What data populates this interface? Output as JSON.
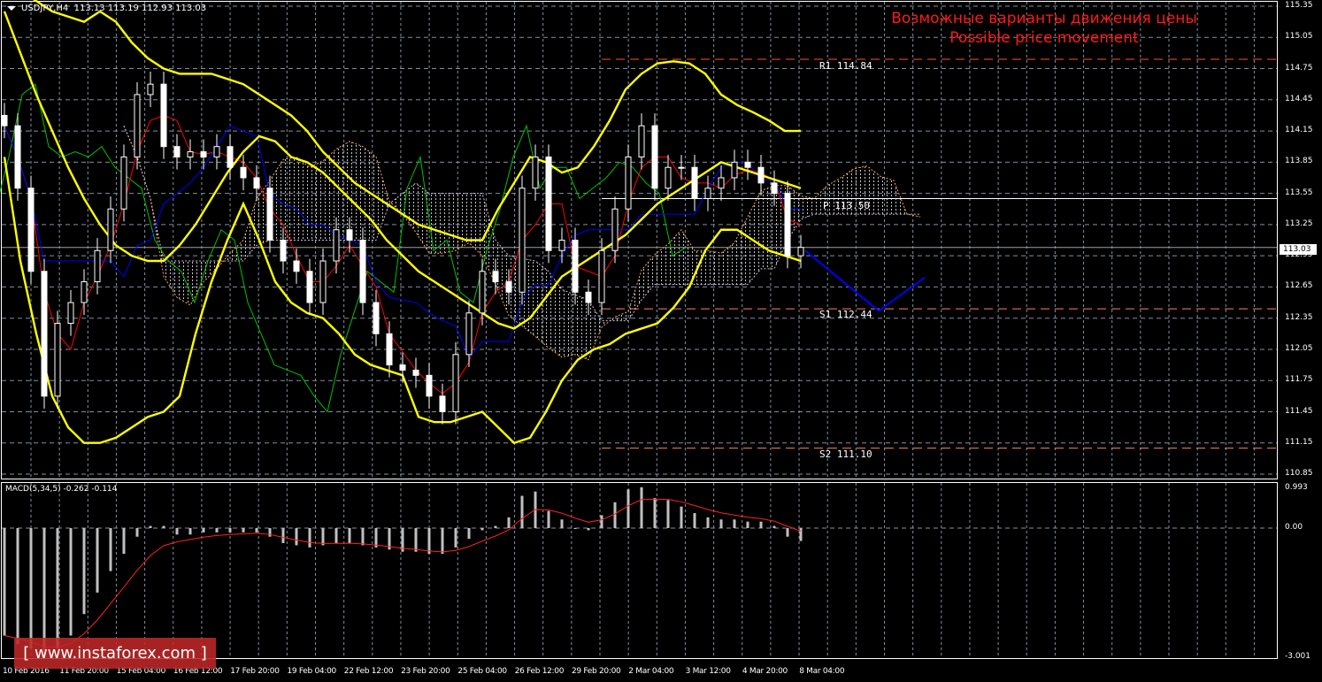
{
  "header": {
    "symbol": "USDJPY,H4",
    "ohlc": "113.13 113.19 112.93 113.03"
  },
  "title": {
    "ru": "Возможные варианты движения цены",
    "en": "Possible price movement"
  },
  "watermark": "[ www.instaforex.com ]",
  "colors": {
    "background": "#000000",
    "bands": "#ffff00",
    "tenkan": "#ff0000",
    "kijun": "#0000ff",
    "chikou": "#00c000",
    "forecast": "#0000ff",
    "title": "#ff1a1a",
    "levels": "#ff6040",
    "grid": "#8090a0"
  },
  "chart_data": [
    {
      "type": "candlestick",
      "title": "USDJPY,H4",
      "ylim": [
        110.85,
        115.35
      ],
      "y_ticks": [
        "115.35",
        "115.05",
        "114.75",
        "114.45",
        "114.15",
        "113.85",
        "113.55",
        "113.25",
        "112.95",
        "112.65",
        "112.35",
        "112.05",
        "111.75",
        "111.45",
        "111.15",
        "110.85"
      ],
      "x_ticks": [
        "10 Feb 2016",
        "11 Feb 20:00",
        "15 Feb 04:00",
        "16 Feb 12:00",
        "17 Feb 20:00",
        "19 Feb 04:00",
        "22 Feb 12:00",
        "23 Feb 20:00",
        "25 Feb 04:00",
        "26 Feb 12:00",
        "29 Feb 20:00",
        "2 Mar 04:00",
        "3 Mar 12:00",
        "4 Mar 20:00",
        "8 Mar 04:00"
      ],
      "current_price": "113.03",
      "closes": [
        114.2,
        113.6,
        112.8,
        111.6,
        112.3,
        112.5,
        112.7,
        113.0,
        113.4,
        113.9,
        114.5,
        114.6,
        114.0,
        113.9,
        113.95,
        113.9,
        114.0,
        113.8,
        113.7,
        113.6,
        113.1,
        112.9,
        112.8,
        112.5,
        112.9,
        113.2,
        113.1,
        112.5,
        112.2,
        111.9,
        111.85,
        111.8,
        111.6,
        111.45,
        112.0,
        112.4,
        112.8,
        112.7,
        112.6,
        113.6,
        113.9,
        113.0,
        113.1,
        112.6,
        112.5,
        113.0,
        113.4,
        113.9,
        114.2,
        113.6,
        113.8,
        113.8,
        113.5,
        113.6,
        113.7,
        113.85,
        113.8,
        113.65,
        113.55,
        112.95,
        113.03
      ],
      "bollinger": {
        "upper": [
          115.6,
          115.5,
          115.4,
          115.3,
          115.25,
          115.2,
          115.3,
          115.2,
          115.0,
          114.85,
          114.75,
          114.7,
          114.7,
          114.7,
          114.65,
          114.6,
          114.5,
          114.4,
          114.3,
          114.15,
          113.95,
          113.8,
          113.65,
          113.55,
          113.45,
          113.35,
          113.25,
          113.2,
          113.15,
          113.1,
          113.1,
          113.4,
          113.65,
          113.9,
          113.85,
          113.75,
          113.8,
          114.0,
          114.25,
          114.55,
          114.7,
          114.8,
          114.82,
          114.8,
          114.7,
          114.5,
          114.4,
          114.33,
          114.25,
          114.15,
          114.15
        ],
        "middle": [
          115.3,
          114.9,
          114.5,
          114.15,
          113.8,
          113.5,
          113.25,
          113.05,
          112.95,
          112.9,
          112.9,
          113.05,
          113.25,
          113.5,
          113.75,
          113.95,
          114.1,
          114.05,
          113.9,
          113.85,
          113.75,
          113.6,
          113.45,
          113.3,
          113.1,
          112.95,
          112.8,
          112.7,
          112.6,
          112.5,
          112.4,
          112.3,
          112.25,
          112.35,
          112.55,
          112.75,
          112.85,
          112.95,
          113.05,
          113.15,
          113.3,
          113.45,
          113.55,
          113.65,
          113.75,
          113.85,
          113.8,
          113.75,
          113.7,
          113.65,
          113.6
        ],
        "lower": [
          113.9,
          112.9,
          112.2,
          111.6,
          111.3,
          111.15,
          111.15,
          111.2,
          111.3,
          111.4,
          111.45,
          111.6,
          112.2,
          112.7,
          113.1,
          113.45,
          113.1,
          112.7,
          112.5,
          112.4,
          112.35,
          112.2,
          112.0,
          111.9,
          111.85,
          111.8,
          111.4,
          111.35,
          111.35,
          111.4,
          111.45,
          111.3,
          111.15,
          111.2,
          111.45,
          111.75,
          111.95,
          112.05,
          112.1,
          112.2,
          112.25,
          112.3,
          112.45,
          112.65,
          113.0,
          113.2,
          113.2,
          113.1,
          113.0,
          112.95,
          112.9
        ]
      },
      "levels": [
        {
          "label": "R1 114.84",
          "value": 114.84
        },
        {
          "label": "P 113.50",
          "value": 113.5
        },
        {
          "label": "S1 112.44",
          "value": 112.44
        },
        {
          "label": "S2 111.10",
          "value": 111.1
        }
      ],
      "forecast": [
        113.0,
        112.42,
        112.74
      ]
    },
    {
      "type": "bar",
      "title": "MACD(5,34,5) -0.262 -0.114",
      "ylim": [
        -3.001,
        0.993
      ],
      "y_ticks": [
        "0.993",
        "0.00",
        "-3.001"
      ],
      "values": [
        -2.5,
        -2.7,
        -2.8,
        -3.0,
        -2.8,
        -2.5,
        -2.0,
        -1.5,
        -1.0,
        -0.6,
        -0.2,
        0.05,
        0.05,
        -0.15,
        -0.15,
        -0.1,
        -0.1,
        -0.1,
        -0.1,
        -0.1,
        -0.2,
        -0.35,
        -0.4,
        -0.45,
        -0.4,
        -0.35,
        -0.35,
        -0.4,
        -0.45,
        -0.5,
        -0.55,
        -0.55,
        -0.6,
        -0.6,
        -0.45,
        -0.25,
        -0.05,
        0.05,
        0.25,
        0.75,
        0.85,
        0.4,
        0.2,
        0.0,
        -0.05,
        0.3,
        0.6,
        0.9,
        0.95,
        0.7,
        0.65,
        0.5,
        0.35,
        0.25,
        0.2,
        0.2,
        0.15,
        0.15,
        0.05,
        -0.2,
        -0.3
      ]
    }
  ]
}
